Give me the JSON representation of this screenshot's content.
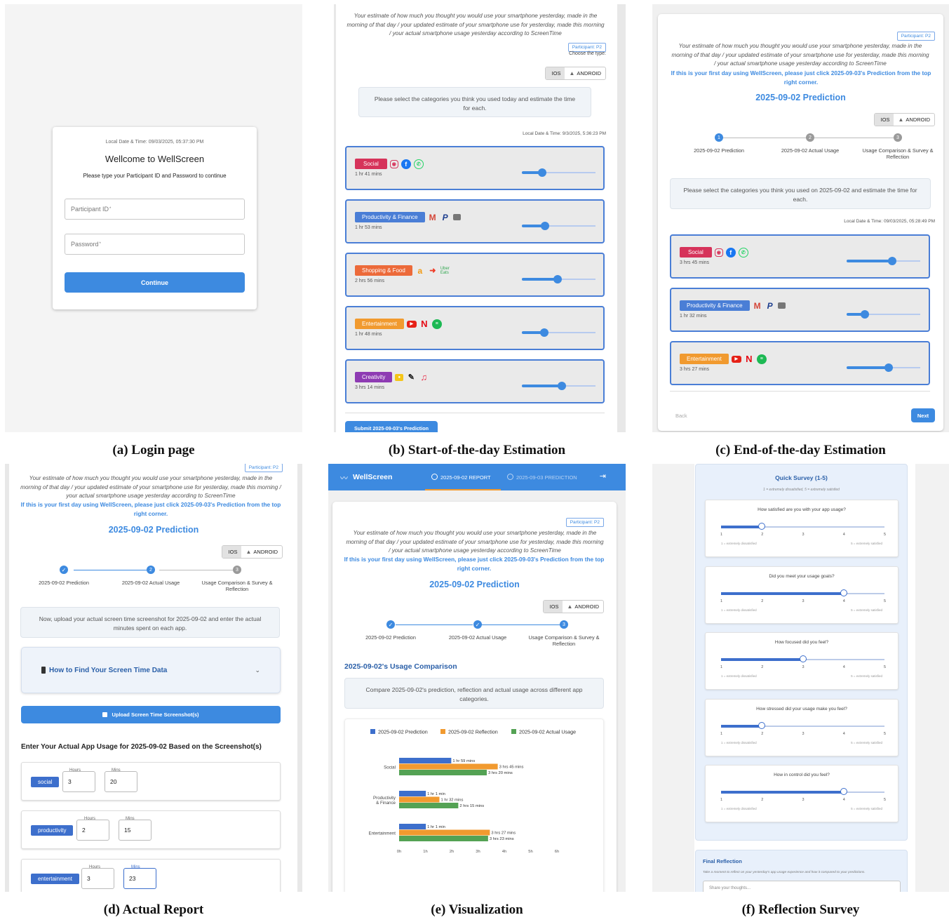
{
  "captions": {
    "a": "(a) Login page",
    "b": "(b) Start-of-the-day Estimation",
    "c": "(c) End-of-the-day Estimation",
    "d": "(d) Actual Report",
    "e": "(e) Visualization",
    "f": "(f) Reflection Survey"
  },
  "login": {
    "datetime": "Local Date & Time: 09/03/2025, 05:37:30 PM",
    "title": "Wellcome to WellScreen",
    "subtitle": "Please type your Participant ID and Password to continue",
    "pid_placeholder": "Participant ID",
    "pw_placeholder": "Password",
    "required_mark": "*",
    "continue": "Continue"
  },
  "common": {
    "intro_text": "Your estimate of how much you thought you would use your smartphone yesterday, made in the morning of that day / your updated estimate of your smartphone use for yesterday, made this morning / your actual smartphone usage yesterday according to ScreenTime",
    "first_day_text": "If this is your first day using WellScreen, please just click 2025-09-03's Prediction from the top right corner.",
    "participant": "Participant: P2",
    "ios": "IOS",
    "android": "ANDROID",
    "prediction_title": "2025-09-02 Prediction",
    "steps": [
      "2025-09-02 Prediction",
      "2025-09-02 Actual Usage",
      "Usage Comparison & Survey & Reflection"
    ],
    "step_nums": [
      "1",
      "2",
      "3"
    ],
    "check": "✓"
  },
  "start": {
    "choose_type": "Choose the type:",
    "info": "Please select the categories you think you used today and estimate the time for each.",
    "datetime": "Local Date & Time: 9/3/2025, 5:36:23 PM",
    "cards": [
      {
        "category": "Social",
        "time": "1 hr 41 mins",
        "color": "#d6335a",
        "level": 0.28
      },
      {
        "category": "Productivity & Finance",
        "time": "1 hr 53 mins",
        "color": "#4a7ed6",
        "level": 0.31
      },
      {
        "category": "Shopping & Food",
        "time": "2 hrs 56 mins",
        "color": "#ec6a3a",
        "level": 0.49
      },
      {
        "category": "Entertainment",
        "time": "1 hr 48 mins",
        "color": "#f19a2f",
        "level": 0.3
      },
      {
        "category": "Creativity",
        "time": "3 hrs 14 mins",
        "color": "#8e3bb3",
        "level": 0.54
      }
    ],
    "uber_eats": "Uber Eats",
    "submit": "Submit 2025-09-03's Prediction"
  },
  "end": {
    "info": "Please select the categories you think you used on 2025-09-02 and estimate the time for each.",
    "datetime": "Local Date & Time: 09/03/2025, 05:28:49 PM",
    "cards": [
      {
        "category": "Social",
        "time": "3 hrs 45 mins",
        "color": "#d6335a",
        "level": 0.62
      },
      {
        "category": "Productivity & Finance",
        "time": "1 hr 32 mins",
        "color": "#4a7ed6",
        "level": 0.25
      },
      {
        "category": "Entertainment",
        "time": "3 hrs 27 mins",
        "color": "#f19a2f",
        "level": 0.57
      }
    ],
    "back": "Back",
    "next": "Next"
  },
  "actual": {
    "info": "Now, upload your actual screen time screenshot for 2025-09-02 and enter the actual minutes spent on each app.",
    "howto": "How to Find Your Screen Time Data",
    "upload": "Upload Screen Time Screenshot(s)",
    "enter_title": "Enter Your Actual App Usage for 2025-09-02 Based on the Screenshot(s)",
    "hours_label": "Hours",
    "mins_label": "Mins",
    "rows": [
      {
        "category": "social",
        "hours": "3",
        "mins": "20"
      },
      {
        "category": "productivity",
        "hours": "2",
        "mins": "15"
      },
      {
        "category": "entertainment",
        "hours": "3",
        "mins": "23"
      }
    ]
  },
  "viz": {
    "brand": "WellScreen",
    "nav_report": "2025-09-02 REPORT",
    "nav_prediction": "2025-09-03 PREDICTION",
    "comparison_title": "2025-09-02's Usage Comparison",
    "comparison_info": "Compare 2025-09-02's prediction, reflection and actual usage across different app categories.",
    "chart_data": {
      "type": "bar",
      "orientation": "horizontal",
      "categories": [
        "Social",
        "Productivity & Finance",
        "Entertainment"
      ],
      "series": [
        {
          "name": "2025-09-02 Prediction",
          "values": [
            1.983,
            1.017,
            1.017
          ],
          "labels": [
            "1 hr 59 mins",
            "1 hr 1 min",
            "1 hr 1 min"
          ],
          "color": "#3d6fcc"
        },
        {
          "name": "2025-09-02 Reflection",
          "values": [
            3.75,
            1.533,
            3.45
          ],
          "labels": [
            "3 hrs 45 mins",
            "1 hr 32 mins",
            "3 hrs 27 mins"
          ],
          "color": "#f19a2f"
        },
        {
          "name": "2025-09-02 Actual Usage",
          "values": [
            3.333,
            2.25,
            3.383
          ],
          "labels": [
            "3 hrs 20 mins",
            "2 hrs 15 mins",
            "3 hrs 23 mins"
          ],
          "color": "#54a254"
        }
      ],
      "xticks": [
        "0h",
        "1h",
        "2h",
        "3h",
        "4h",
        "5h",
        "6h"
      ],
      "xlim": [
        0,
        6
      ],
      "legend": "top",
      "grid": false
    }
  },
  "survey": {
    "title": "Quick Survey (1-5)",
    "scale_note": "1 = extremely dissatisfied, 5 = extremely satisfied",
    "ticks": [
      "1",
      "2",
      "3",
      "4",
      "5"
    ],
    "low": "1 = extremely dissatisfied",
    "high": "5 = extremely satisfied",
    "questions": [
      {
        "q": "How satisfied are you with your app usage?",
        "value": 2
      },
      {
        "q": "Did you meet your usage goals?",
        "value": 4
      },
      {
        "q": "How focused did you feel?",
        "value": 3
      },
      {
        "q": "How stressed did your usage make you feel?",
        "value": 2
      },
      {
        "q": "How in control did you feel?",
        "value": 4
      }
    ],
    "final_title": "Final Reflection",
    "final_prompt": "Take a moment to reflect on your yesterday's app usage experience and how it compared to your predictions.",
    "final_placeholder": "Share your thoughts..."
  }
}
